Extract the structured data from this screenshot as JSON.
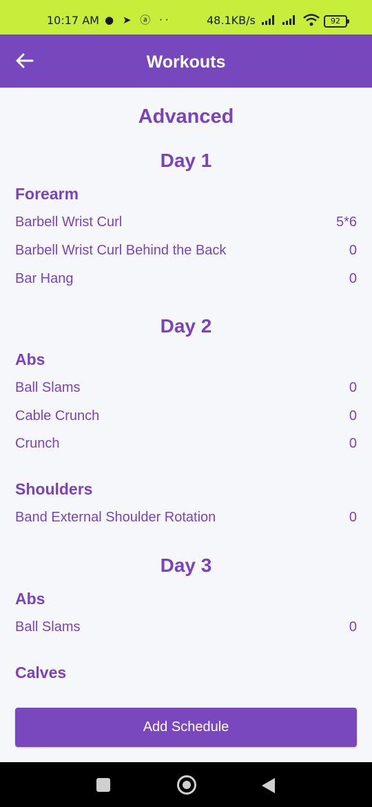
{
  "status_bar": {
    "time": "10:17 AM",
    "left_icons": "● ➤ ⓐ ··",
    "speed": "48.1KB/s",
    "battery": "92"
  },
  "app_bar": {
    "title": "Workouts",
    "back_icon": "arrow-left-icon"
  },
  "level": "Advanced",
  "days": [
    {
      "title": "Day 1",
      "groups": [
        {
          "title": "Forearm",
          "exercises": [
            {
              "name": "Barbell Wrist Curl",
              "value": "5*6"
            },
            {
              "name": "Barbell Wrist Curl Behind the Back",
              "value": "0"
            },
            {
              "name": "Bar Hang",
              "value": "0"
            }
          ]
        }
      ]
    },
    {
      "title": "Day 2",
      "groups": [
        {
          "title": "Abs",
          "exercises": [
            {
              "name": "Ball Slams",
              "value": "0"
            },
            {
              "name": "Cable Crunch",
              "value": "0"
            },
            {
              "name": "Crunch",
              "value": "0"
            }
          ]
        },
        {
          "title": "Shoulders",
          "exercises": [
            {
              "name": "Band External Shoulder Rotation",
              "value": "0"
            }
          ]
        }
      ]
    },
    {
      "title": "Day 3",
      "groups": [
        {
          "title": "Abs",
          "exercises": [
            {
              "name": "Ball Slams",
              "value": "0"
            }
          ]
        },
        {
          "title": "Calves",
          "exercises": []
        }
      ]
    }
  ],
  "add_button": "Add Schedule",
  "colors": {
    "status_bar": "#c6ee3b",
    "app_bar": "#7747bd",
    "accent_text": "#7a43bd",
    "background": "#f5f7fa"
  }
}
